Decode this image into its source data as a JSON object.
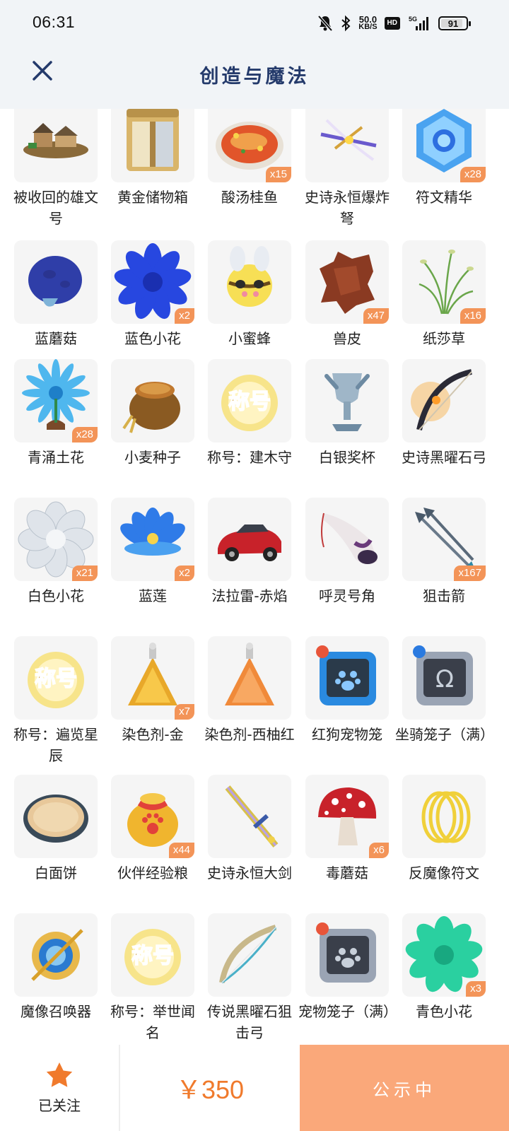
{
  "status_bar": {
    "time": "06:31",
    "net_speed_value": "50.0",
    "net_speed_unit": "KB/S",
    "hd": "HD",
    "network": "5G",
    "battery": "91"
  },
  "header": {
    "title": "创造与魔法",
    "close_icon": "close-icon"
  },
  "items": [
    {
      "name": "被收回的雄文号",
      "qty": "",
      "icon": "house-boat"
    },
    {
      "name": "黄金储物箱",
      "qty": "",
      "icon": "golden-cabinet"
    },
    {
      "name": "酸汤桂鱼",
      "qty": "x15",
      "icon": "fish-soup"
    },
    {
      "name": "史诗永恒爆炸弩",
      "qty": "",
      "icon": "crossbow"
    },
    {
      "name": "符文精华",
      "qty": "x28",
      "icon": "rune-crystal"
    },
    {
      "name": "蓝蘑菇",
      "qty": "",
      "icon": "blue-mushroom"
    },
    {
      "name": "蓝色小花",
      "qty": "x2",
      "icon": "blue-flower"
    },
    {
      "name": "小蜜蜂",
      "qty": "",
      "icon": "bee"
    },
    {
      "name": "兽皮",
      "qty": "x47",
      "icon": "hide"
    },
    {
      "name": "纸莎草",
      "qty": "x16",
      "icon": "papyrus"
    },
    {
      "name": "青涌土花",
      "qty": "x28",
      "icon": "cyan-flower"
    },
    {
      "name": "小麦种子",
      "qty": "",
      "icon": "seed-sack"
    },
    {
      "name": "称号：建木守",
      "qty": "",
      "icon": "title-badge"
    },
    {
      "name": "白银奖杯",
      "qty": "",
      "icon": "silver-trophy"
    },
    {
      "name": "史诗黑曜石弓",
      "qty": "",
      "icon": "obsidian-bow"
    },
    {
      "name": "白色小花",
      "qty": "x21",
      "icon": "white-flower"
    },
    {
      "name": "蓝莲",
      "qty": "x2",
      "icon": "blue-lotus"
    },
    {
      "name": "法拉雷-赤焰",
      "qty": "",
      "icon": "red-car"
    },
    {
      "name": "呼灵号角",
      "qty": "",
      "icon": "horn"
    },
    {
      "name": "狙击箭",
      "qty": "x167",
      "icon": "arrows"
    },
    {
      "name": "称号：遍览星辰",
      "qty": "",
      "icon": "title-badge"
    },
    {
      "name": "染色剂-金",
      "qty": "x7",
      "icon": "dye-gold"
    },
    {
      "name": "染色剂-西柚红",
      "qty": "",
      "icon": "dye-orange"
    },
    {
      "name": "红狗宠物笼",
      "qty": "",
      "icon": "pet-cage-blue"
    },
    {
      "name": "坐骑笼子（满）",
      "qty": "",
      "icon": "mount-cage"
    },
    {
      "name": "白面饼",
      "qty": "",
      "icon": "flatbread"
    },
    {
      "name": "伙伴经验粮",
      "qty": "x44",
      "icon": "exp-bag"
    },
    {
      "name": "史诗永恒大剑",
      "qty": "",
      "icon": "great-sword"
    },
    {
      "name": "毒蘑菇",
      "qty": "x6",
      "icon": "red-mushroom"
    },
    {
      "name": "反魔像符文",
      "qty": "",
      "icon": "gold-rings"
    },
    {
      "name": "魔像召唤器",
      "qty": "",
      "icon": "golem-summoner"
    },
    {
      "name": "称号：举世闻名",
      "qty": "",
      "icon": "title-badge"
    },
    {
      "name": "传说黑曜石狙击弓",
      "qty": "",
      "icon": "sniper-bow"
    },
    {
      "name": "宠物笼子（满）",
      "qty": "",
      "icon": "pet-cage-grey"
    },
    {
      "name": "青色小花",
      "qty": "x3",
      "icon": "teal-flower"
    }
  ],
  "title_badge_text": "称号",
  "bottom_bar": {
    "follow_label": "已关注",
    "price": "￥350",
    "action_label": "公示中",
    "accent_color": "#f07a2c"
  }
}
